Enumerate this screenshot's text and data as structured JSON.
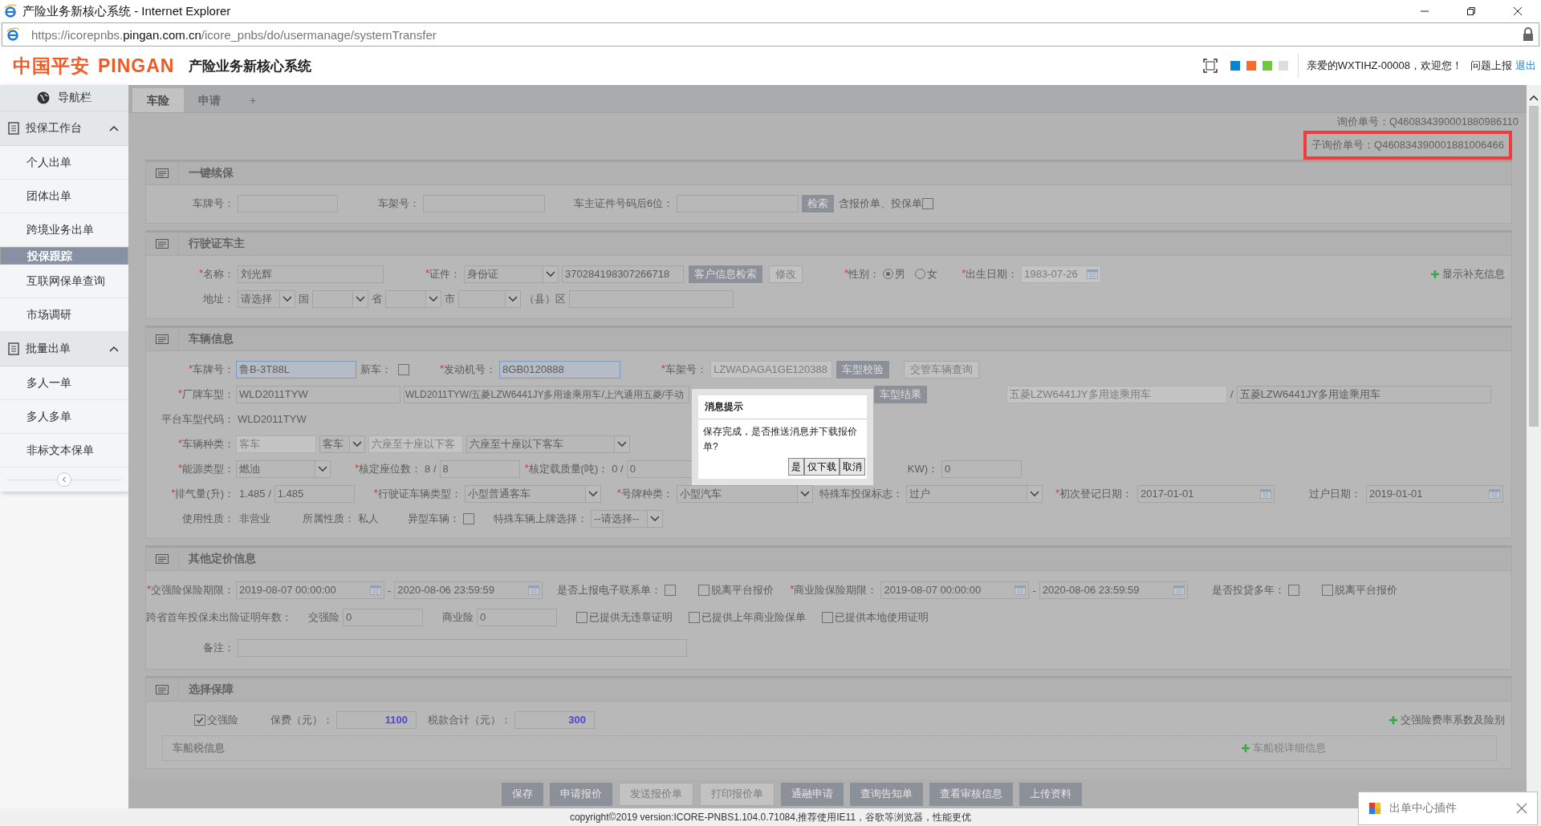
{
  "window": {
    "title": "产险业务新核心系统 - Internet Explorer"
  },
  "address_bar": {
    "url_prefix": "https://icorepnbs.",
    "url_domain": "pingan.com.cn",
    "url_path": "/icore_pnbs/do/usermanage/systemTransfer"
  },
  "header": {
    "logo_cn": "中国平安",
    "logo_en": "PINGAN",
    "system_name": "产险业务新核心系统",
    "theme_colors": [
      {
        "color": "#0a84d0"
      },
      {
        "color": "#f76b2f"
      },
      {
        "color": "#6fc93f"
      },
      {
        "color": "#dddddd"
      }
    ],
    "greeting": "亲爱的WXTIHZ-00008，欢迎您！",
    "report_link": "问题上报",
    "logout_link": "退出"
  },
  "sidebar": {
    "title": "导航栏",
    "groups": [
      {
        "label": "投保工作台",
        "expanded": true,
        "items": [
          {
            "label": "个人出单",
            "selected": false
          },
          {
            "label": "团体出单",
            "selected": false
          },
          {
            "label": "跨境业务出单",
            "selected": false
          },
          {
            "label": "投保跟踪",
            "selected": true
          },
          {
            "label": "互联网保单查询",
            "selected": false
          },
          {
            "label": "市场调研",
            "selected": false
          }
        ]
      },
      {
        "label": "批量出单",
        "expanded": true,
        "items": [
          {
            "label": "多人一单",
            "selected": false
          },
          {
            "label": "多人多单",
            "selected": false
          },
          {
            "label": "非标文本保单",
            "selected": false
          }
        ]
      }
    ]
  },
  "tabs": [
    {
      "label": "车险",
      "selected": true
    },
    {
      "label": "申请",
      "selected": false
    }
  ],
  "add_tab": "+",
  "quote_numbers": [
    {
      "text": "询价单号：Q460834390001880986110",
      "annotated": false
    },
    {
      "text": "子询价单号：Q460834390001881006466",
      "annotated": true
    }
  ],
  "sections": [
    {
      "title": "一键续保",
      "rows": [
        {
          "items": [
            {
              "kind": "label",
              "text": "车牌号："
            },
            {
              "kind": "input"
            },
            {
              "kind": "label",
              "text": "车架号："
            },
            {
              "kind": "input"
            },
            {
              "kind": "label",
              "text": "车主证件号码后6位："
            },
            {
              "kind": "input"
            },
            {
              "kind": "button",
              "label": "检索",
              "disabled": false
            },
            {
              "kind": "text",
              "text": "含报价单、投保单"
            },
            {
              "kind": "checkbox",
              "checked": false
            }
          ]
        }
      ]
    },
    {
      "title": "行驶证车主",
      "rows": [
        {
          "items": [
            {
              "kind": "label",
              "marker": "*",
              "text": "名称："
            },
            {
              "kind": "input",
              "value": "刘光辉"
            },
            {
              "kind": "label",
              "marker": "*",
              "text": "证件："
            },
            {
              "kind": "select",
              "value": "身份证"
            },
            {
              "kind": "input",
              "value": "370284198307266718"
            },
            {
              "kind": "button",
              "label": "客户信息检索",
              "disabled": false
            },
            {
              "kind": "button",
              "label": "修改",
              "disabled": true
            },
            {
              "kind": "label",
              "marker": "*",
              "text": "性别："
            },
            {
              "kind": "radio",
              "label": "男",
              "selected": true
            },
            {
              "kind": "radio",
              "label": "女",
              "selected": false
            },
            {
              "kind": "label",
              "marker": "*",
              "text": "出生日期："
            },
            {
              "kind": "date",
              "value": "1983-07-26",
              "disabled": true
            },
            {
              "kind": "link",
              "text": "显示补充信息"
            }
          ]
        },
        {
          "items": [
            {
              "kind": "label",
              "text": "地址："
            },
            {
              "kind": "select",
              "value": "请选择"
            },
            {
              "kind": "text",
              "text": "国"
            },
            {
              "kind": "select"
            },
            {
              "kind": "text",
              "text": "省"
            },
            {
              "kind": "select"
            },
            {
              "kind": "text",
              "text": "市"
            },
            {
              "kind": "select"
            },
            {
              "kind": "text",
              "text": "（县）区"
            },
            {
              "kind": "input"
            }
          ]
        }
      ]
    },
    {
      "title": "车辆信息",
      "rows": [
        {
          "items": [
            {
              "kind": "label",
              "marker": "*",
              "text": "车牌号："
            },
            {
              "kind": "input",
              "value": "鲁B-3T88L",
              "highlighted": true
            },
            {
              "kind": "label",
              "text": "新车："
            },
            {
              "kind": "checkbox",
              "checked": false
            },
            {
              "kind": "label",
              "marker": "*",
              "text": "发动机号："
            },
            {
              "kind": "input",
              "value": "8GB0120888",
              "highlighted": true
            },
            {
              "kind": "label",
              "marker": "*",
              "text": "车架号："
            },
            {
              "kind": "input",
              "value": "LZWADAGA1GE120388",
              "disabled": true
            },
            {
              "kind": "button",
              "label": "车型校验",
              "disabled": false
            },
            {
              "kind": "button",
              "label": "交管车辆查询",
              "disabled": true
            }
          ]
        },
        {
          "items": [
            {
              "kind": "label",
              "marker": "*",
              "text": "厂牌车型："
            },
            {
              "kind": "input",
              "value": "WLD2011TYW"
            },
            {
              "kind": "input",
              "value": "WLD2011TYW/五菱LZW6441JY多用途乘用车/上汽通用五菱/手动"
            },
            {
              "kind": "button",
              "label": "车型结果",
              "disabled": false
            },
            {
              "kind": "input",
              "value": "五菱LZW6441JY多用途乘用车",
              "disabled": true
            },
            {
              "kind": "text",
              "text": "/"
            },
            {
              "kind": "input",
              "value": "五菱LZW6441JY多用途乘用车"
            }
          ]
        },
        {
          "items": [
            {
              "kind": "label",
              "text": "平台车型代码："
            },
            {
              "kind": "text",
              "text": "WLD2011TYW"
            }
          ]
        },
        {
          "items": [
            {
              "kind": "label",
              "marker": "*",
              "text": "车辆种类："
            },
            {
              "kind": "input",
              "value": "客车",
              "disabled": true
            },
            {
              "kind": "select",
              "value": "客车"
            },
            {
              "kind": "input",
              "value": "六座至十座以下客",
              "disabled": true
            },
            {
              "kind": "select",
              "value": "六座至十座以下客车"
            }
          ]
        },
        {
          "items": [
            {
              "kind": "label",
              "marker": "*",
              "text": "能源类型："
            },
            {
              "kind": "select",
              "value": "燃油"
            },
            {
              "kind": "label",
              "marker": "*",
              "text": "核定座位数："
            },
            {
              "kind": "text",
              "text": "8 /"
            },
            {
              "kind": "input",
              "value": "8"
            },
            {
              "kind": "label",
              "marker": "*",
              "text": "核定载质量(吨)："
            },
            {
              "kind": "text",
              "text": "0 /"
            },
            {
              "kind": "input",
              "value": "0"
            },
            {
              "kind": "label",
              "text": "KW)："
            },
            {
              "kind": "input",
              "value": "0"
            }
          ]
        },
        {
          "items": [
            {
              "kind": "label",
              "marker": "*",
              "text": "排气量(升)："
            },
            {
              "kind": "text",
              "text": "1.485 /"
            },
            {
              "kind": "input",
              "value": "1.485"
            },
            {
              "kind": "label",
              "marker": "*",
              "text": "行驶证车辆类型："
            },
            {
              "kind": "select",
              "value": "小型普通客车"
            },
            {
              "kind": "label",
              "marker": "*",
              "text": "号牌种类："
            },
            {
              "kind": "select",
              "value": "小型汽车"
            },
            {
              "kind": "label",
              "text": "特殊车投保标志："
            },
            {
              "kind": "select",
              "value": "过户"
            },
            {
              "kind": "label",
              "marker": "*",
              "text": "初次登记日期："
            },
            {
              "kind": "date",
              "value": "2017-01-01"
            },
            {
              "kind": "label",
              "text": "过户日期："
            },
            {
              "kind": "date",
              "value": "2019-01-01"
            }
          ]
        },
        {
          "items": [
            {
              "kind": "label",
              "text": "使用性质："
            },
            {
              "kind": "text",
              "text": "非营业"
            },
            {
              "kind": "label",
              "text": "所属性质："
            },
            {
              "kind": "text",
              "text": "私人"
            },
            {
              "kind": "label",
              "text": "异型车辆："
            },
            {
              "kind": "checkbox",
              "checked": false
            },
            {
              "kind": "label",
              "text": "特殊车辆上牌选择："
            },
            {
              "kind": "select",
              "value": "--请选择--"
            }
          ]
        }
      ]
    },
    {
      "title": "其他定价信息",
      "rows": [
        {
          "items": [
            {
              "kind": "label",
              "marker": "*",
              "text": "交强险保险期限："
            },
            {
              "kind": "date",
              "value": "2019-08-07 00:00:00"
            },
            {
              "kind": "text",
              "text": "-"
            },
            {
              "kind": "date",
              "value": "2020-08-06 23:59:59"
            },
            {
              "kind": "label",
              "text": "是否上报电子联系单："
            },
            {
              "kind": "checkbox",
              "checked": false
            },
            {
              "kind": "checkbox",
              "label": "脱离平台报价",
              "checked": false
            },
            {
              "kind": "label",
              "marker": "*",
              "text": "商业险保险期限："
            },
            {
              "kind": "date",
              "value": "2019-08-07 00:00:00"
            },
            {
              "kind": "text",
              "text": "-"
            },
            {
              "kind": "date",
              "value": "2020-08-06 23:59:59"
            },
            {
              "kind": "label",
              "text": "是否投贷多年："
            },
            {
              "kind": "checkbox",
              "checked": false
            },
            {
              "kind": "checkbox",
              "label": "脱离平台报价",
              "checked": false
            }
          ]
        },
        {
          "items": [
            {
              "kind": "label",
              "text": "跨省首年投保未出险证明年数："
            },
            {
              "kind": "label",
              "text": "交强险"
            },
            {
              "kind": "input",
              "value": "0"
            },
            {
              "kind": "label",
              "text": "商业险"
            },
            {
              "kind": "input",
              "value": "0"
            },
            {
              "kind": "checkbox",
              "label": "已提供无违章证明",
              "checked": false
            },
            {
              "kind": "checkbox",
              "label": "已提供上年商业险保单",
              "checked": false
            },
            {
              "kind": "checkbox",
              "label": "已提供本地使用证明",
              "checked": false
            }
          ]
        },
        {
          "items": [
            {
              "kind": "label",
              "text": "备注："
            },
            {
              "kind": "input"
            }
          ]
        }
      ]
    },
    {
      "title": "选择保障",
      "rows": [
        {
          "items": [
            {
              "kind": "checkbox",
              "label": "交强险",
              "checked": true
            },
            {
              "kind": "label",
              "text": "保费（元）："
            },
            {
              "kind": "amount",
              "value": "1100"
            },
            {
              "kind": "label",
              "text": "税款合计（元）："
            },
            {
              "kind": "amount",
              "value": "300"
            },
            {
              "kind": "link",
              "text": "交强险费率系数及险别"
            }
          ]
        }
      ],
      "sub_panel": {
        "title": "车船税信息",
        "link": "车船税详细信息"
      }
    }
  ],
  "dialog": {
    "title": "消息提示",
    "message": "保存完成，是否推送消息并下载报价单?",
    "buttons": [
      "是",
      "仅下载",
      "取消"
    ]
  },
  "action_buttons": [
    {
      "label": "保存",
      "disabled": false
    },
    {
      "label": "申请报价",
      "disabled": false
    },
    {
      "label": "发送报价单",
      "disabled": true
    },
    {
      "label": "打印报价单",
      "disabled": true
    },
    {
      "label": "通融申请",
      "disabled": false
    },
    {
      "label": "查询告知单",
      "disabled": false
    },
    {
      "label": "查看审核信息",
      "disabled": false
    },
    {
      "label": "上传资料",
      "disabled": false
    }
  ],
  "footer": {
    "copyright": "copyright©2019 version:ICORE-PNBS1.104.0.71084,推荐使用IE11，谷歌等浏览器，性能更优"
  },
  "plugin_popup": {
    "title": "出单中心插件"
  }
}
